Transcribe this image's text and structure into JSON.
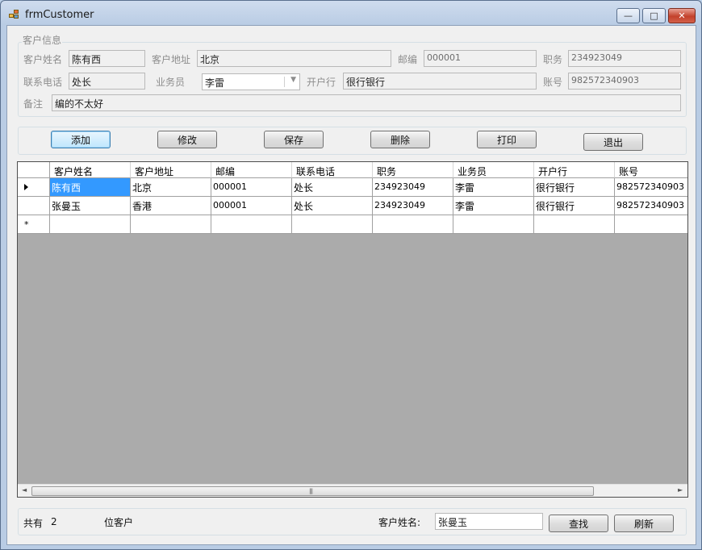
{
  "window": {
    "title": "frmCustomer",
    "min_label": "—",
    "max_label": "□",
    "close_label": "✕"
  },
  "info": {
    "legend": "客户信息",
    "name_label": "客户姓名",
    "name_value": "陈有西",
    "address_label": "客户地址",
    "address_value": "北京",
    "postcode_label": "邮编",
    "postcode_value": "000001",
    "title_label": "职务",
    "title_value": "234923049",
    "phone_label": "联系电话",
    "phone_value": "处长",
    "salesman_label": "业务员",
    "salesman_value": "李雷",
    "bank_label": "开户行",
    "bank_value": "很行银行",
    "account_label": "账号",
    "account_value": "982572340903",
    "remark_label": "备注",
    "remark_value": "编的不太好"
  },
  "toolbar": {
    "add_label": "添加",
    "edit_label": "修改",
    "save_label": "保存",
    "delete_label": "删除",
    "print_label": "打印",
    "exit_label": "退出"
  },
  "grid": {
    "columns": [
      "客户姓名",
      "客户地址",
      "邮编",
      "联系电话",
      "职务",
      "业务员",
      "开户行",
      "账号"
    ],
    "rows": [
      [
        "陈有西",
        "北京",
        "000001",
        "处长",
        "234923049",
        "李雷",
        "很行银行",
        "982572340903"
      ],
      [
        "张曼玉",
        "香港",
        "000001",
        "处长",
        "234923049",
        "李雷",
        "很行银行",
        "982572340903"
      ]
    ],
    "new_row_marker": "*"
  },
  "status": {
    "total_prefix": "共有",
    "total_count": "2",
    "total_suffix": "位客户",
    "search_label": "客户姓名:",
    "search_value": "张曼玉",
    "find_label": "查找",
    "refresh_label": "刷新"
  }
}
